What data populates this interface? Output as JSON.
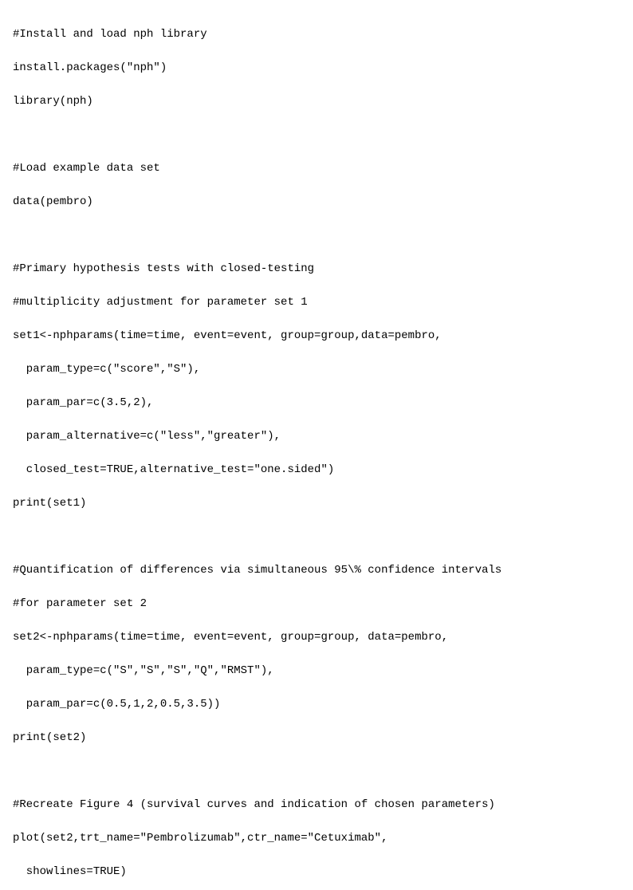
{
  "code": {
    "sections": [
      {
        "id": "install-section",
        "lines": [
          "#Install and load nph library",
          "install.packages(\"nph\")",
          "library(nph)"
        ]
      },
      {
        "id": "blank1",
        "lines": [
          ""
        ]
      },
      {
        "id": "load-section",
        "lines": [
          "#Load example data set",
          "data(pembro)"
        ]
      },
      {
        "id": "blank2",
        "lines": [
          ""
        ]
      },
      {
        "id": "primary-section",
        "lines": [
          "#Primary hypothesis tests with closed-testing",
          "#multiplicity adjustment for parameter set 1",
          "set1<-nphparams(time=time, event=event, group=group,data=pembro,",
          "  param_type=c(\"score\",\"S\"),",
          "  param_par=c(3.5,2),",
          "  param_alternative=c(\"less\",\"greater\"),",
          "  closed_test=TRUE,alternative_test=\"one.sided\")",
          "print(set1)"
        ]
      },
      {
        "id": "blank3",
        "lines": [
          ""
        ]
      },
      {
        "id": "quantification-section",
        "lines": [
          "#Quantification of differences via simultaneous 95\\% confidence intervals",
          "#for parameter set 2",
          "set2<-nphparams(time=time, event=event, group=group, data=pembro,",
          "  param_type=c(\"S\",\"S\",\"S\",\"Q\",\"RMST\"),",
          "  param_par=c(0.5,1,2,0.5,3.5))",
          "print(set2)"
        ]
      },
      {
        "id": "blank4",
        "lines": [
          ""
        ]
      },
      {
        "id": "recreate-section",
        "lines": [
          "#Recreate Figure 4 (survival curves and indication of chosen parameters)",
          "plot(set2,trt_name=\"Pembrolizumab\",ctr_name=\"Cetuximab\",",
          "  showlines=TRUE)"
        ]
      }
    ]
  }
}
